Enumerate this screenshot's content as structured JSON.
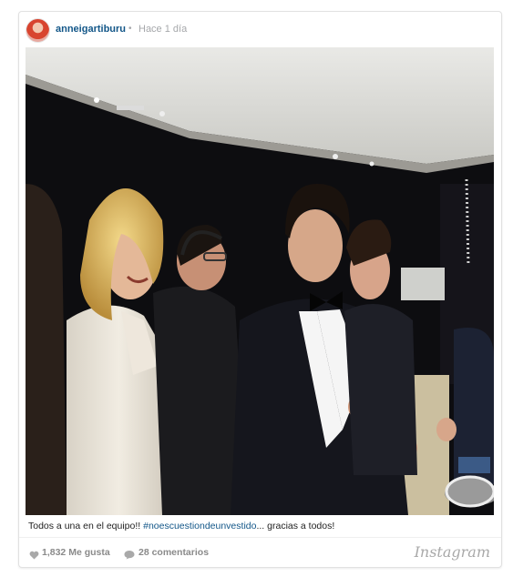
{
  "post": {
    "username": "anneigartiburu",
    "separator": "•",
    "time": "Hace 1 día",
    "caption_text": "Todos a una en el equipo!! ",
    "caption_hashtag": "#noescuestiondeunvestido",
    "caption_suffix": "... gracias a todos!",
    "likes": "1,832 Me gusta",
    "comments": "28 comentarios",
    "brand": "Instagram"
  },
  "icons": {
    "likes": "heart-icon",
    "comments": "speech-bubble-icon"
  },
  "colors": {
    "username": "#125688",
    "hashtag": "#125688",
    "meta": "#a5a7aa",
    "footer_text": "#8a8a8a"
  }
}
